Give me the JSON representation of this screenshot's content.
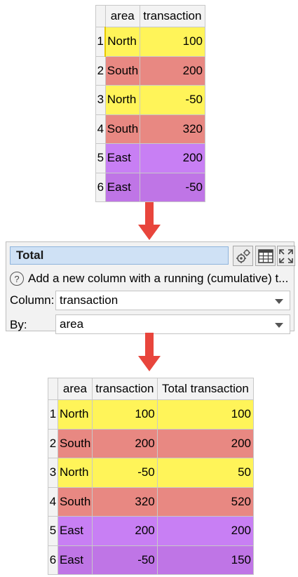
{
  "input_table": {
    "headers": [
      "",
      "area",
      "transaction"
    ],
    "rows": [
      {
        "num": "1",
        "area": "North",
        "transaction": "100"
      },
      {
        "num": "2",
        "area": "South",
        "transaction": "200"
      },
      {
        "num": "3",
        "area": "North",
        "transaction": "-50"
      },
      {
        "num": "4",
        "area": "South",
        "transaction": "320"
      },
      {
        "num": "5",
        "area": "East",
        "transaction": "200"
      },
      {
        "num": "6",
        "area": "East",
        "transaction": "-50"
      }
    ]
  },
  "panel": {
    "title": "Total",
    "help_text": "Add a new column with a running (cumulative) t...",
    "column_label": "Column:",
    "column_value": "transaction",
    "by_label": "By:",
    "by_value": "area",
    "icons": [
      "settings-gears-icon",
      "table-icon",
      "expand-icon",
      "help-icon",
      "chevron-down-icon"
    ]
  },
  "output_table": {
    "headers": [
      "",
      "area",
      "transaction",
      "Total transaction"
    ],
    "rows": [
      {
        "num": "1",
        "area": "North",
        "transaction": "100",
        "total": "100"
      },
      {
        "num": "2",
        "area": "South",
        "transaction": "200",
        "total": "200"
      },
      {
        "num": "3",
        "area": "North",
        "transaction": "-50",
        "total": "50"
      },
      {
        "num": "4",
        "area": "South",
        "transaction": "320",
        "total": "520"
      },
      {
        "num": "5",
        "area": "East",
        "transaction": "200",
        "total": "200"
      },
      {
        "num": "6",
        "area": "East",
        "transaction": "-50",
        "total": "150"
      }
    ]
  },
  "colors": {
    "north": "#fff459",
    "south": "#e88882",
    "east": "#c87ff4",
    "arrow": "#e8453c",
    "title_bg": "#cfe1f5"
  }
}
